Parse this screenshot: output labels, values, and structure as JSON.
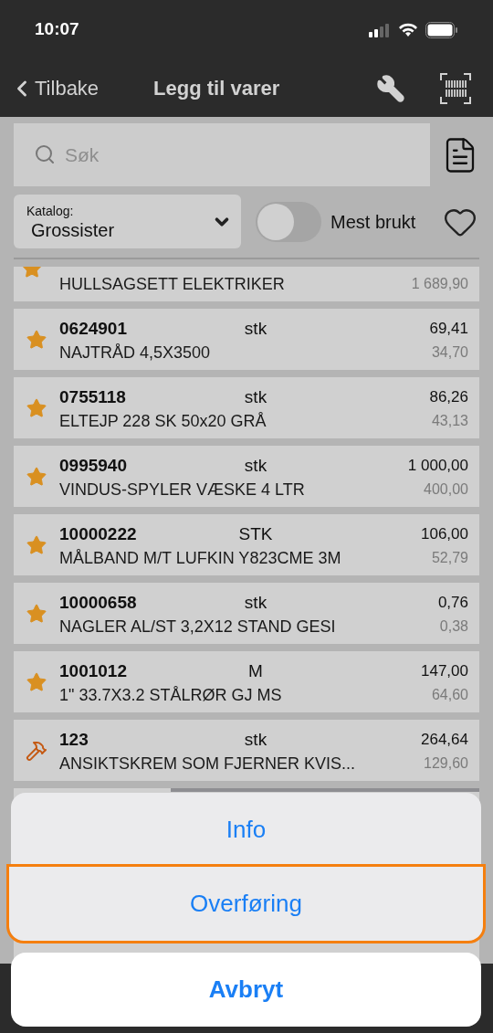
{
  "status_bar": {
    "time": "10:07"
  },
  "nav": {
    "back": "Tilbake",
    "title": "Legg til varer"
  },
  "search": {
    "placeholder": "Søk"
  },
  "catalog": {
    "label": "Katalog:",
    "value": "Grossister"
  },
  "most_used": {
    "label": "Mest brukt",
    "on": false
  },
  "items": [
    {
      "kind": "star",
      "name": "HULLSAGSETT ELEKTRIKER",
      "price_2": "1 689,90"
    },
    {
      "kind": "star",
      "code": "0624901",
      "unit": "stk",
      "price_1": "69,41",
      "name": "NAJTRÅD 4,5X3500",
      "price_2": "34,70"
    },
    {
      "kind": "star",
      "code": "0755118",
      "unit": "stk",
      "price_1": "86,26",
      "name": "ELTEJP 228 SK 50x20 GRÅ",
      "price_2": "43,13"
    },
    {
      "kind": "star",
      "code": "0995940",
      "unit": "stk",
      "price_1": "1 000,00",
      "name": "VINDUS-SPYLER VÆSKE 4 LTR",
      "price_2": "400,00"
    },
    {
      "kind": "star",
      "code": "10000222",
      "unit": "STK",
      "price_1": "106,00",
      "name": "MÅLBAND M/T LUFKIN Y823CME 3M",
      "price_2": "52,79"
    },
    {
      "kind": "star",
      "code": "10000658",
      "unit": "stk",
      "price_1": "0,76",
      "name": "NAGLER AL/ST 3,2X12 STAND GESI",
      "price_2": "0,38"
    },
    {
      "kind": "star",
      "code": "1001012",
      "unit": "M",
      "price_1": "147,00",
      "name": "1\" 33.7X3.2 STÅLRØR GJ MS",
      "price_2": "64,60"
    },
    {
      "kind": "hammer",
      "code": "123",
      "unit": "stk",
      "price_1": "264,64",
      "name": "ANSIKTSKREM SOM FJERNER KVIS...",
      "price_2": "129,60"
    }
  ],
  "action_sheet": {
    "options": [
      {
        "label": "Info",
        "highlighted": false
      },
      {
        "label": "Overføring",
        "highlighted": true
      }
    ],
    "cancel": "Avbryt"
  }
}
